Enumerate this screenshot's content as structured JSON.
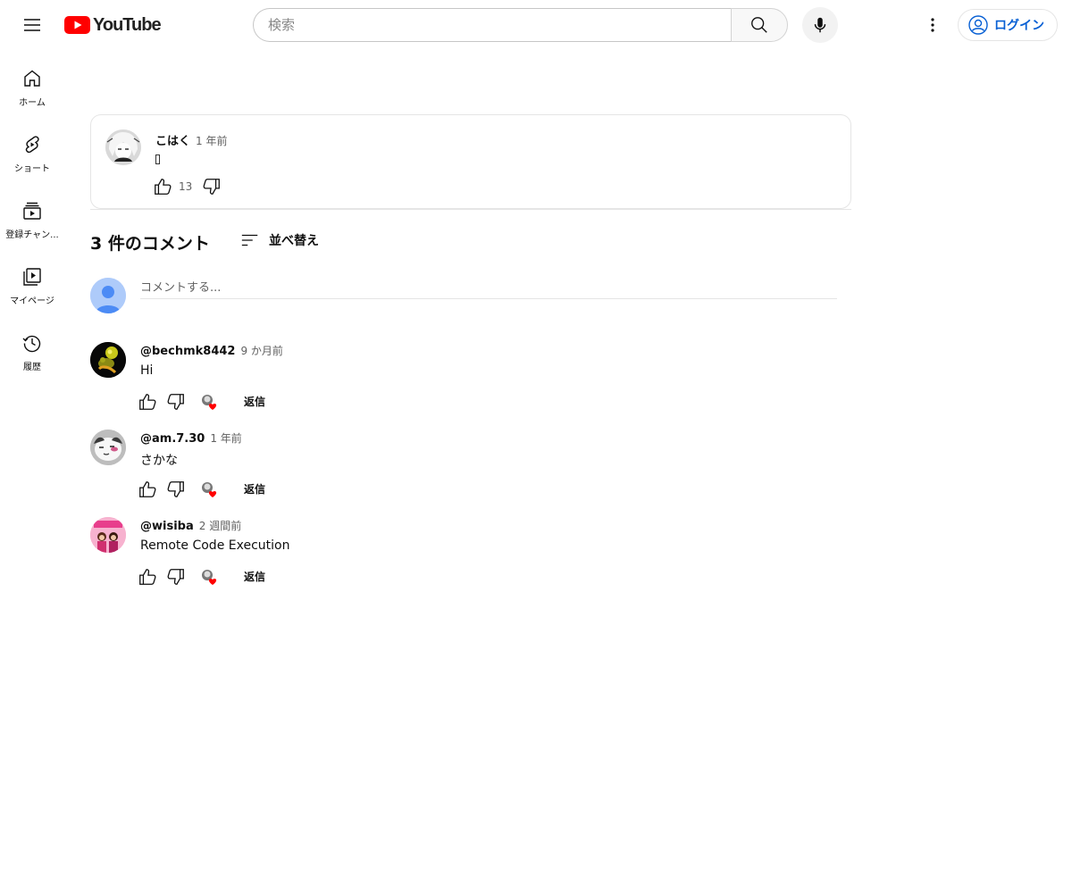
{
  "header": {
    "logo_text": "YouTube",
    "search_placeholder": "検索",
    "login_label": "ログイン"
  },
  "sidebar": {
    "items": [
      {
        "label": "ホーム",
        "icon": "home-icon"
      },
      {
        "label": "ショート",
        "icon": "shorts-icon"
      },
      {
        "label": "登録チャン...",
        "icon": "subscriptions-icon"
      },
      {
        "label": "マイページ",
        "icon": "library-icon"
      },
      {
        "label": "履歴",
        "icon": "history-icon"
      }
    ]
  },
  "pinned": {
    "author": "こはく",
    "time": "1 年前",
    "text": "",
    "likes": "13"
  },
  "comments_section": {
    "count_label": "3 件のコメント",
    "sort_label": "並べ替え",
    "add_placeholder": "コメントする..."
  },
  "comments": [
    {
      "author": "@bechmk8442",
      "time": "9 か月前",
      "text": "Hi",
      "reply_label": "返信"
    },
    {
      "author": "@am.7.30",
      "time": "1 年前",
      "text": "さかな",
      "reply_label": "返信"
    },
    {
      "author": "@wisiba",
      "time": "2 週間前",
      "text": "Remote Code Execution",
      "reply_label": "返信"
    }
  ],
  "colors": {
    "brand_red": "#ff0000",
    "link_blue": "#065fd4",
    "heart_red": "#ff0000"
  }
}
